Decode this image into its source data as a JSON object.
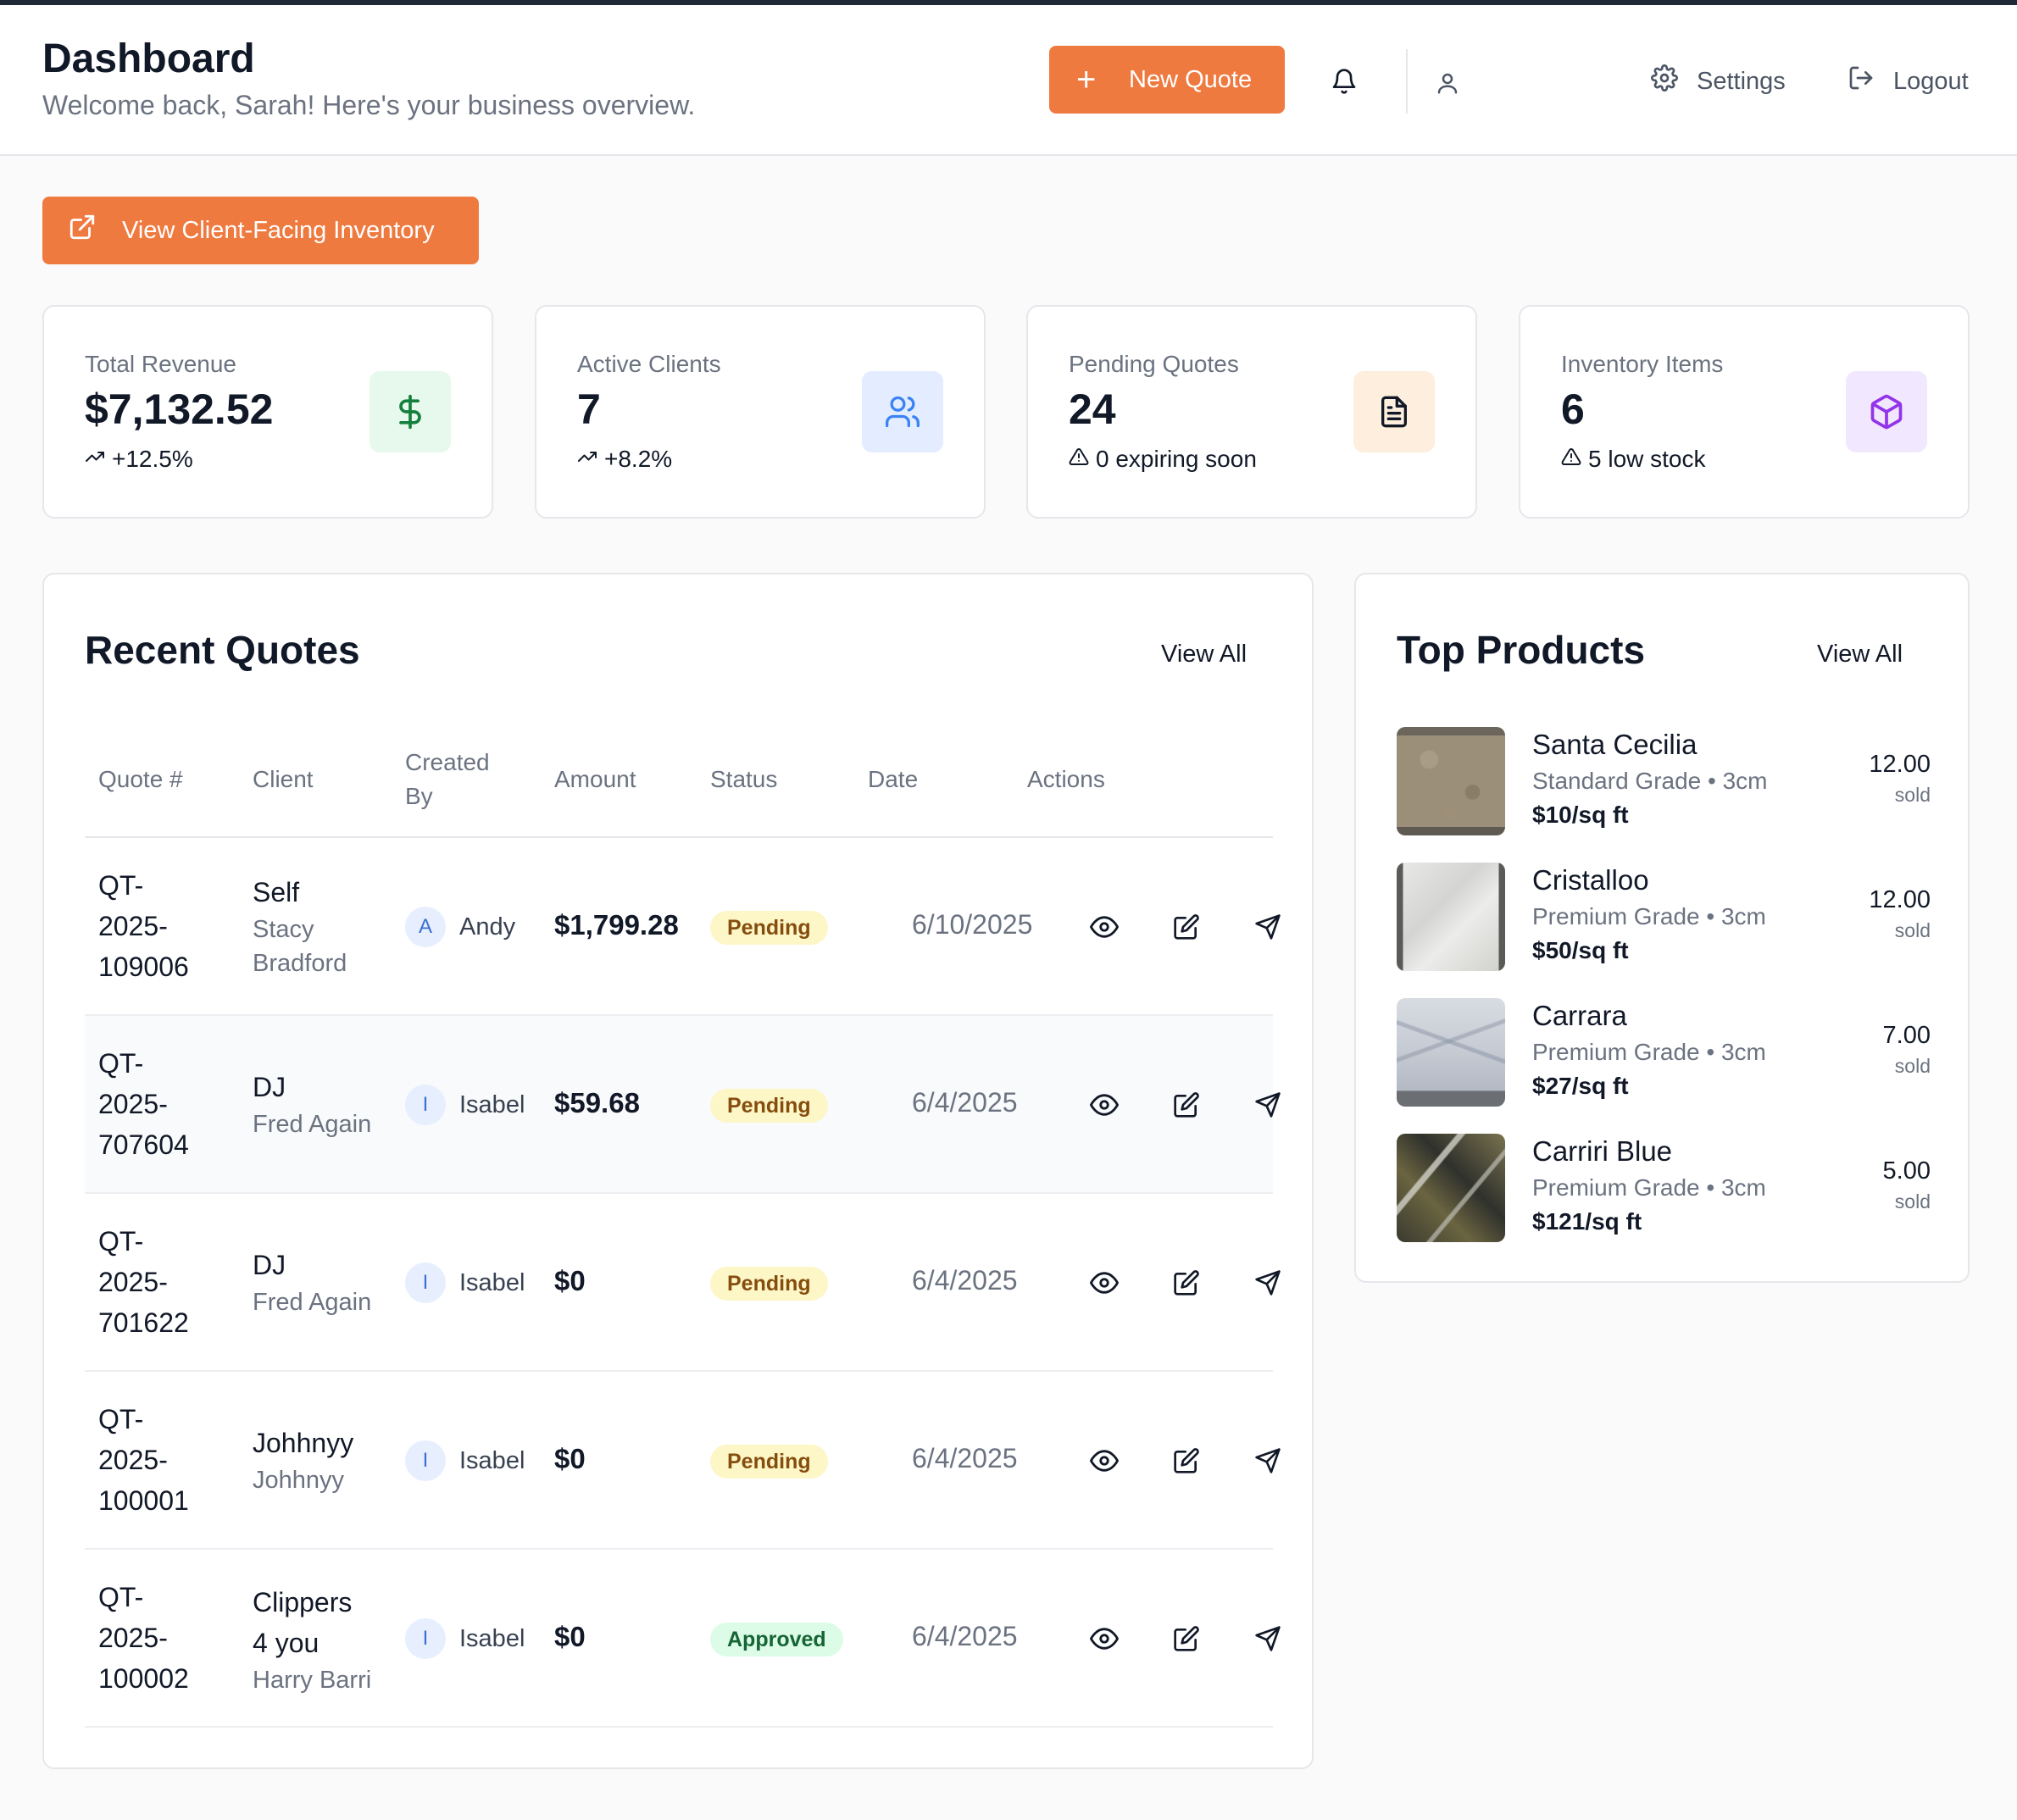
{
  "header": {
    "title": "Dashboard",
    "subtitle": "Welcome back, Sarah! Here's your business overview.",
    "new_quote_label": "New Quote",
    "settings_label": "Settings",
    "logout_label": "Logout"
  },
  "inventory_button_label": "View Client-Facing Inventory",
  "stats": [
    {
      "label": "Total Revenue",
      "value": "$7,132.52",
      "sub": "+12.5%",
      "icon": "dollar-icon",
      "icon_bg": "#e7f8ec",
      "icon_color": "#15803d"
    },
    {
      "label": "Active Clients",
      "value": "7",
      "sub": "+8.2%",
      "icon": "users-icon",
      "icon_bg": "#e3edff",
      "icon_color": "#3b82f6"
    },
    {
      "label": "Pending Quotes",
      "value": "24",
      "sub": "0 expiring soon",
      "icon": "document-icon",
      "icon_bg": "#fdeedd",
      "icon_color": "#111827"
    },
    {
      "label": "Inventory Items",
      "value": "6",
      "sub": "5 low stock",
      "icon": "box-icon",
      "icon_bg": "#f1e8ff",
      "icon_color": "#9333ea"
    }
  ],
  "recent_quotes": {
    "title": "Recent Quotes",
    "view_all": "View All",
    "columns": {
      "quote": "Quote #",
      "client": "Client",
      "created_by_1": "Created",
      "created_by_2": "By",
      "amount": "Amount",
      "status": "Status",
      "date": "Date",
      "actions": "Actions"
    },
    "rows": [
      {
        "q1": "QT-",
        "q2": "2025-",
        "q3": "109006",
        "client": "Self",
        "client_sub1": "Stacy",
        "client_sub2": "Bradford",
        "initial": "A",
        "creator": "Andy",
        "amount": "$1,799.28",
        "status": "Pending",
        "date": "6/10/2025"
      },
      {
        "q1": "QT-",
        "q2": "2025-",
        "q3": "707604",
        "client": "DJ",
        "client_sub1": "Fred Again",
        "initial": "I",
        "creator": "Isabel",
        "amount": "$59.68",
        "status": "Pending",
        "date": "6/4/2025"
      },
      {
        "q1": "QT-",
        "q2": "2025-",
        "q3": "701622",
        "client": "DJ",
        "client_sub1": "Fred Again",
        "initial": "I",
        "creator": "Isabel",
        "amount": "$0",
        "status": "Pending",
        "date": "6/4/2025"
      },
      {
        "q1": "QT-",
        "q2": "2025-",
        "q3": "100001",
        "client": "Johhnyy",
        "client_sub1": "Johhnyy",
        "initial": "I",
        "creator": "Isabel",
        "amount": "$0",
        "status": "Pending",
        "date": "6/4/2025"
      },
      {
        "q1": "QT-",
        "q2": "2025-",
        "q3": "100002",
        "client": "Clippers",
        "client2": "4 you",
        "client_sub1": "Harry Barri",
        "initial": "I",
        "creator": "Isabel",
        "amount": "$0",
        "status": "Approved",
        "date": "6/4/2025"
      }
    ]
  },
  "top_products": {
    "title": "Top Products",
    "view_all": "View All",
    "items": [
      {
        "name": "Santa Cecilia",
        "grade": "Standard Grade • 3cm",
        "price": "$10/sq ft",
        "sold": "12.00",
        "sold_label": "sold",
        "image": "granite-slab"
      },
      {
        "name": "Cristalloo",
        "grade": "Premium Grade • 3cm",
        "price": "$50/sq ft",
        "sold": "12.00",
        "sold_label": "sold",
        "image": "white-marble-slab"
      },
      {
        "name": "Carrara",
        "grade": "Premium Grade • 3cm",
        "price": "$27/sq ft",
        "sold": "7.00",
        "sold_label": "sold",
        "image": "carrara-marble-slab"
      },
      {
        "name": "Carriri Blue",
        "grade": "Premium Grade • 3cm",
        "price": "$121/sq ft",
        "sold": "5.00",
        "sold_label": "sold",
        "image": "dark-stone-slab"
      }
    ]
  },
  "colors": {
    "accent": "#ef7a40",
    "pending_bg": "#fdf6c6",
    "approved_bg": "#dcfce7"
  }
}
